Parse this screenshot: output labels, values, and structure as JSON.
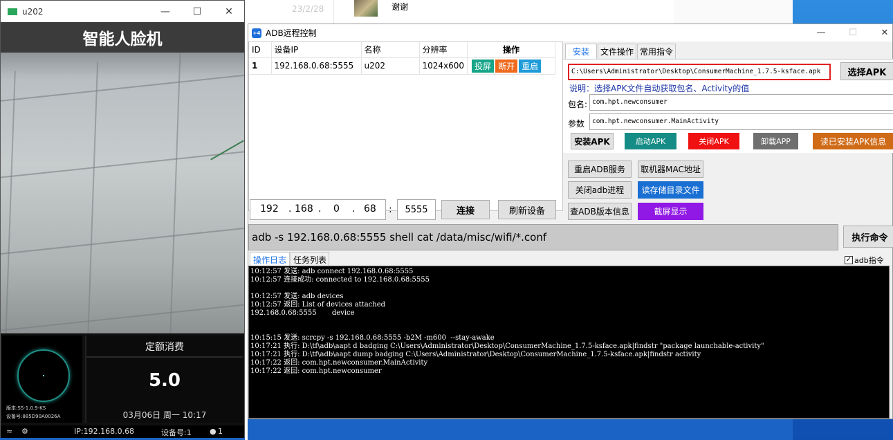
{
  "background_chat": {
    "date": "23/2/28",
    "message": "谢谢"
  },
  "face_window": {
    "title": "u202",
    "header": "智能人脸机",
    "version": "版本:SS-1.0.9-KS",
    "device_no": "设备号:885D90A0026A",
    "consume_title": "定额消费",
    "amount": "5.0",
    "datetime": "03月06日 周一 10:17",
    "status_ip": "IP:192.168.0.68",
    "status_devices": "设备号:1",
    "status_users": "1"
  },
  "adb": {
    "title": "ADB远程控制",
    "table": {
      "headers": [
        "ID",
        "设备IP",
        "名称",
        "分辨率",
        "操作"
      ],
      "rows": [
        {
          "id": "1",
          "ip": "192.168.0.68:5555",
          "name": "u202",
          "resolution": "1024x600",
          "actions": [
            "投屏",
            "断开",
            "重启"
          ]
        }
      ]
    },
    "connect": {
      "ip_octets": [
        "192",
        "168",
        "0",
        "68"
      ],
      "dot": ".",
      "colon": ":",
      "port": "5555",
      "connect_label": "连接",
      "refresh_label": "刷新设备"
    },
    "tabs": [
      "安装",
      "文件操作",
      "常用指令"
    ],
    "install": {
      "apk_path": "C:\\Users\\Administrator\\Desktop\\ConsumerMachine_1.7.5-ksface.apk",
      "select_apk": "选择APK",
      "note": "说明：选择APK文件自动获取包名、Activity的值",
      "package_label": "包名:",
      "package_value": "com.hpt.newconsumer",
      "param_label": "参数",
      "param_value": "com.hpt.newconsumer.MainActivity",
      "btn_install": "安装APK",
      "btn_start": "启动APK",
      "btn_close": "关闭APK",
      "btn_uninstall": "卸载APP",
      "btn_read_installed": "读已安装APK信息"
    },
    "service_buttons": {
      "restart_adb": "重启ADB服务",
      "get_mac": "取机器MAC地址",
      "close_adb": "关闭adb进程",
      "read_storage": "读存储目录文件",
      "adb_version": "查ADB版本信息",
      "screenshot": "截屏显示"
    },
    "command": "adb -s 192.168.0.68:5555 shell cat /data/misc/wifi/*.conf",
    "exec_label": "执行命令",
    "log_tabs": [
      "操作日志",
      "任务列表"
    ],
    "adb_cmd_checkbox": "adb指令",
    "log_lines": [
      "10:12:57 发送: adb connect 192.168.0.68:5555",
      "10:12:57 连接成功: connected to 192.168.0.68:5555",
      "",
      "10:12:57 发送: adb devices",
      "10:12:57 返回: List of devices attached",
      "192.168.0.68:5555       device",
      "",
      "",
      "10:15:15 发送: scrcpy -s 192.168.0.68:5555 -b2M -m600  --stay-awake",
      "10:17:21 执行: D:\\tf\\adb\\aapt d badging C:\\Users\\Administrator\\Desktop\\ConsumerMachine_1.7.5-ksface.apk|findstr \"package launchable-activity\"",
      "10:17:21 执行: D:\\tf\\adb\\aapt dump badging C:\\Users\\Administrator\\Desktop\\ConsumerMachine_1.7.5-ksface.apk|findstr activity",
      "10:17:22 返回: com.hpt.newconsumer.MainActivity",
      "10:17:22 返回: com.hpt.newconsumer"
    ],
    "colors": {
      "cast": "#17a589",
      "disconnect": "#f06a1d",
      "restart": "#1e9bd8",
      "start_apk": "#158c85",
      "close_apk": "#f01212",
      "uninstall": "#6f6f6f",
      "read_installed": "#cf6a16",
      "read_storage": "#1a6fd3",
      "screenshot": "#9019e6"
    }
  }
}
